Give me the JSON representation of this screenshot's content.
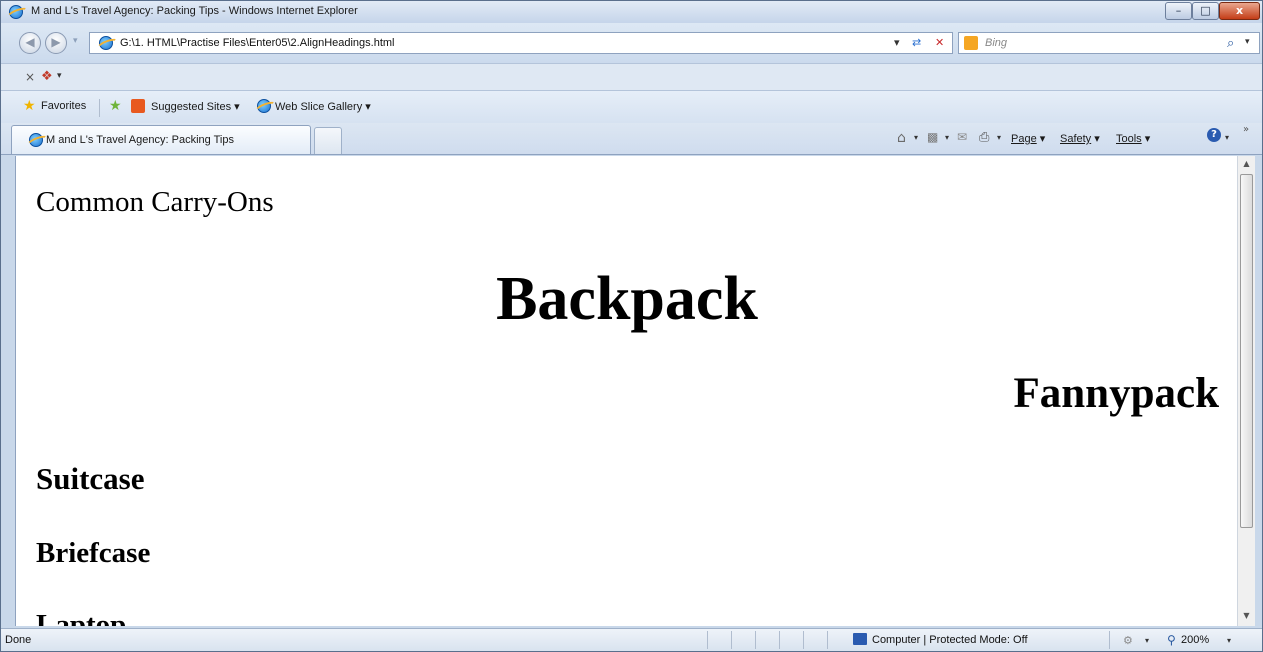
{
  "window": {
    "title": "M and L's Travel Agency: Packing Tips - Windows Internet Explorer",
    "minimize_glyph": "–",
    "maximize_glyph": "□",
    "close_glyph": "x"
  },
  "address_bar": {
    "url": "G:\\1. HTML\\Practise Files\\Enter05\\2.AlignHeadings.html",
    "dropdown_glyph": "▾",
    "refresh_glyph": "⇄",
    "stop_glyph": "✕"
  },
  "search": {
    "placeholder": "Bing",
    "search_glyph": "⌕"
  },
  "toolbar": {
    "close_glyph": "×"
  },
  "favorites_bar": {
    "favorites_label": "Favorites",
    "suggested_sites_label": "Suggested Sites ▾",
    "web_slice_label": "Web Slice Gallery ▾"
  },
  "tabs": [
    {
      "label": "M and L's Travel Agency: Packing Tips"
    }
  ],
  "command_bar": {
    "page_label": "Page",
    "safety_label": "Safety",
    "tools_label": "Tools",
    "chevron": "»"
  },
  "page": {
    "heading_common": "Common Carry-Ons",
    "heading_backpack": "Backpack",
    "heading_fannypack": "Fannypack",
    "heading_suitcase": "Suitcase",
    "heading_briefcase": "Briefcase",
    "heading_laptop": "Laptop"
  },
  "status_bar": {
    "status": "Done",
    "zone": "Computer | Protected Mode: Off",
    "zoom": "200%"
  }
}
